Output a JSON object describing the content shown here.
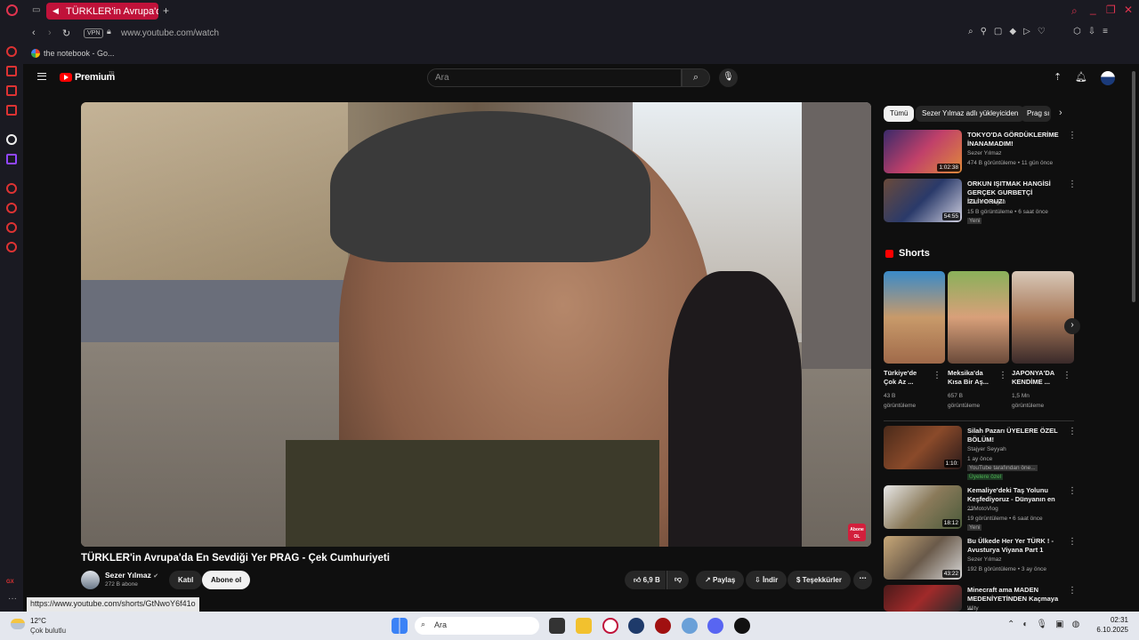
{
  "browser": {
    "tab_title": "TÜRKLER'in Avrupa'da",
    "url": "www.youtube.com/watch",
    "vpn_label": "VPN",
    "bookmark": "the notebook - Go...",
    "status_url": "https://www.youtube.com/shorts/GtNwoY6f41o"
  },
  "yt": {
    "brand": "Premium",
    "brand_sup": "TR",
    "search_placeholder": "Ara",
    "video_title": "TÜRKLER'in Avrupa'da En Sevdiği Yer PRAG - Çek Cumhuriyeti",
    "watermark": "Abone OL",
    "channel": {
      "name": "Sezer Yılmaz",
      "subs": "272 B abone"
    },
    "join_label": "Katıl",
    "subscribe_label": "Abone ol",
    "likes": "6,9 B",
    "share_label": "Paylaş",
    "download_label": "İndir",
    "thanks_label": "Teşekkürler"
  },
  "chips": [
    "Tümü",
    "Sezer Yılmaz adlı yükleyiciden",
    "Prag sı"
  ],
  "recs_top": [
    {
      "title": "TOKYO'DA GÖRDÜKLERİME İNANAMADIM!",
      "channel": "Sezer Yılmaz",
      "meta": "474 B görüntüleme • 11 gün önce",
      "dur": "1:02:38",
      "badge": ""
    },
    {
      "title": "ORKUN IŞITMAK HANGİSİ GERÇEK GURBETÇİ İZLİYORUZ!",
      "channel": "Ataberk Doğan",
      "meta": "15 B görüntüleme • 6 saat önce",
      "dur": "54:55",
      "badge": "Yeni"
    }
  ],
  "shorts_heading": "Shorts",
  "shorts": [
    {
      "title": "Türkiye'de Çok Az ...",
      "views": "43 B görüntüleme"
    },
    {
      "title": "Meksika'da Kısa Bir Aş...",
      "views": "657 B görüntüleme"
    },
    {
      "title": "JAPONYA'DA KENDİME ...",
      "views": "1,5 Mn görüntüleme"
    }
  ],
  "recs_bottom": [
    {
      "title": "Silah Pazarı ÜYELERE ÖZEL BÖLÜM!",
      "channel": "Stajyer Seyyah",
      "meta": "1 ay önce",
      "dur": "1:10:",
      "badge": "YouTube tarafından öne...",
      "badge2": "Üyelere özel"
    },
    {
      "title": "Kemaliye'deki Taş Yolunu Keşfediyoruz - Dünyanın en ...",
      "channel": "23MotoVlog",
      "meta": "19 görüntüleme • 6 saat önce",
      "dur": "18:12",
      "badge": "Yeni",
      "badge2": ""
    },
    {
      "title": "Bu Ülkede Her Yer TÜRK ! - Avusturya Viyana Part 1",
      "channel": "Sezer Yılmaz",
      "meta": "192 B görüntüleme • 3 ay önce",
      "dur": "43:22",
      "badge": "",
      "badge2": ""
    },
    {
      "title": "Minecraft ama MADEN MEDENİYETİNDEN Kaçmaya ...",
      "channel": "Wity",
      "meta": "",
      "dur": "",
      "badge": "",
      "badge2": ""
    }
  ],
  "taskbar": {
    "temp": "12°C",
    "weather": "Çok bulutlu",
    "search": "Ara",
    "time": "02:31",
    "date": "6.10.2025"
  },
  "colors": {
    "accent": "#c0123a",
    "yt_red": "#ff0000"
  }
}
